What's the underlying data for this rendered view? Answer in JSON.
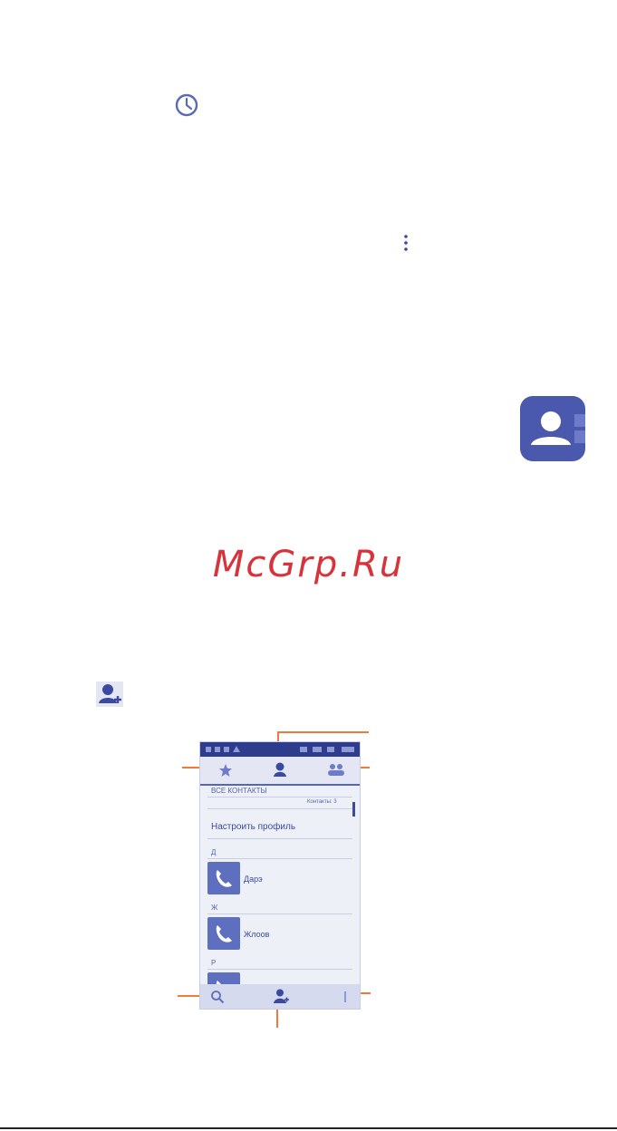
{
  "watermark": "McGrp.Ru",
  "phone": {
    "section_all_contacts": "ВСЕ КОНТАКТЫ",
    "search_hint": "Контакты: 3",
    "profile_label": "Настроить профиль",
    "groups": [
      {
        "letter": "Д",
        "name": "Дарэ"
      },
      {
        "letter": "Ж",
        "name": "Жлоов"
      },
      {
        "letter": "Р",
        "name": ""
      }
    ]
  },
  "icons": {
    "history": "clock-icon",
    "overflow": "overflow-menu-icon",
    "contacts_app": "contacts-app-icon",
    "add_contact": "add-contact-icon",
    "favorites": "star-icon",
    "contacts_tab": "person-icon",
    "groups_tab": "group-icon",
    "search": "search-icon",
    "new": "add-person-icon",
    "menu": "menu-icon"
  },
  "colors": {
    "accent": "#5565b8",
    "status_bar": "#2d3c8c",
    "callout": "#ef7a3b",
    "watermark": "#d8323a"
  }
}
